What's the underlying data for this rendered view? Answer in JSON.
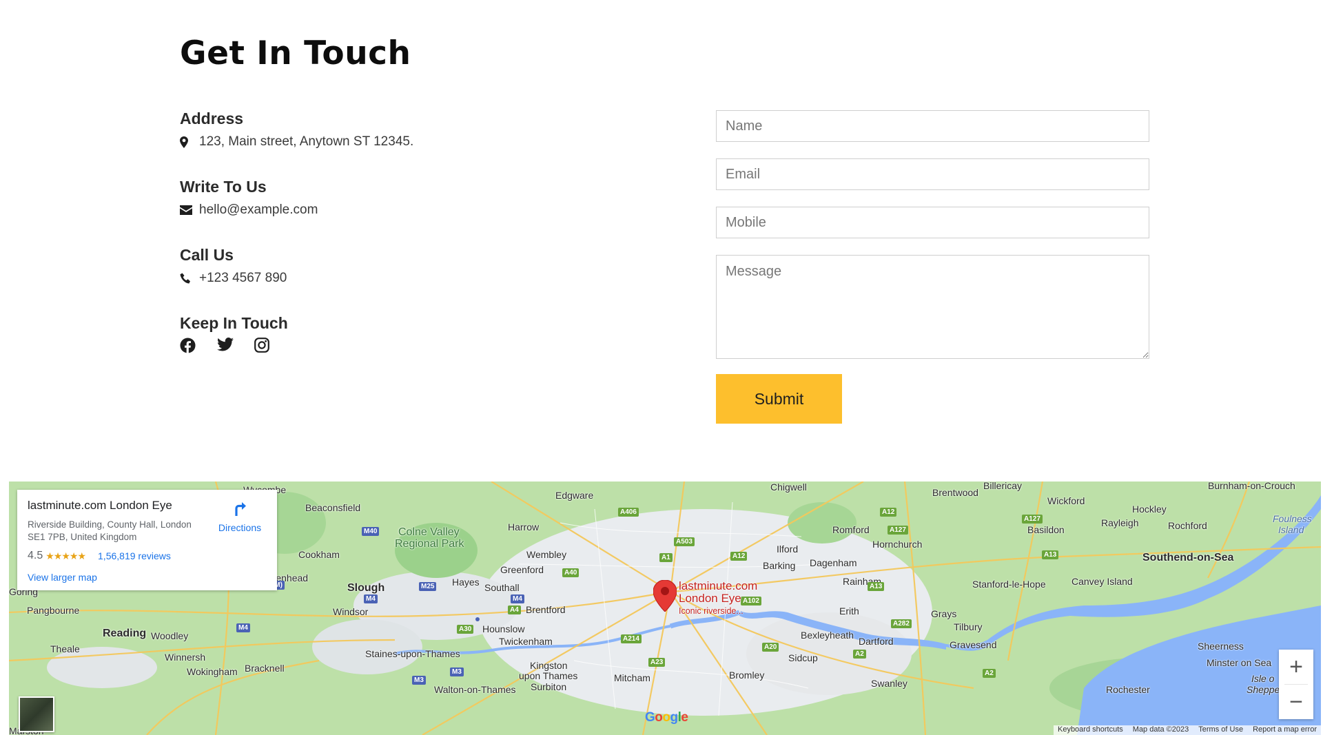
{
  "contact": {
    "title": "Get In Touch",
    "address": {
      "heading": "Address",
      "value": "123, Main street, Anytown ST 12345.",
      "icon": "map-marker-icon"
    },
    "write": {
      "heading": "Write To Us",
      "value": "hello@example.com",
      "icon": "envelope-icon"
    },
    "call": {
      "heading": "Call Us",
      "value": "+123 4567 890",
      "icon": "phone-icon"
    },
    "social": {
      "heading": "Keep In Touch",
      "icons": [
        "facebook-icon",
        "twitter-icon",
        "instagram-icon"
      ]
    }
  },
  "form": {
    "name_placeholder": "Name",
    "email_placeholder": "Email",
    "mobile_placeholder": "Mobile",
    "message_placeholder": "Message",
    "submit_label": "Submit",
    "submit_color": "#fdbf2d"
  },
  "map": {
    "card": {
      "title": "lastminute.com London Eye",
      "address": "Riverside Building, County Hall, London SE1 7PB, United Kingdom",
      "rating": "4.5",
      "stars": "★★★★★",
      "reviews": "1,56,819 reviews",
      "directions": "Directions",
      "larger_map": "View larger map"
    },
    "marker": {
      "line1": "lastminute.com",
      "line2": "London Eye",
      "line3": "Iconic riverside..."
    },
    "zoom_in": "+",
    "zoom_out": "−",
    "google_logo": "Google",
    "attribution": {
      "shortcuts": "Keyboard shortcuts",
      "data": "Map data ©2023",
      "terms": "Terms of Use",
      "report": "Report a map error"
    },
    "places": {
      "chigwell": "Chigwell",
      "brentwood": "Brentwood",
      "billericay": "Billericay",
      "burnham": "Burnham-on-Crouch",
      "edgware": "Edgware",
      "beaconsfield": "Beaconsfield",
      "wickford": "Wickford",
      "hockley": "Hockley",
      "harrow": "Harrow",
      "romford": "Romford",
      "basildon": "Basildon",
      "rayleigh": "Rayleigh",
      "rochford": "Rochford",
      "colne": "Colne Valley",
      "colne2": "Regional Park",
      "hornchurch": "Hornchurch",
      "foulness": "Foulness",
      "foulness2": "Island",
      "wembley": "Wembley",
      "ilford": "Ilford",
      "southend": "Southend-on-Sea",
      "greenford": "Greenford",
      "barking": "Barking",
      "dagenham": "Dagenham",
      "maidenhead": "Maidenhead",
      "hayes": "Hayes",
      "slough": "Slough",
      "southall": "Southall",
      "rainham": "Rainham",
      "stanford": "Stanford-le-Hope",
      "canvey": "Canvey Island",
      "pangbourne": "Pangbourne",
      "windsor": "Windsor",
      "brentford": "Brentford",
      "erith": "Erith",
      "grays": "Grays",
      "reading": "Reading",
      "woodley": "Woodley",
      "hounslow": "Hounslow",
      "tilbury": "Tilbury",
      "bexleyheath": "Bexleyheath",
      "theale": "Theale",
      "twickenham": "Twickenham",
      "dartford": "Dartford",
      "gravesend": "Gravesend",
      "sheerness": "Sheerness",
      "winnersh": "Winnersh",
      "staines": "Staines-upon-Thames",
      "sidcup": "Sidcup",
      "minster": "Minster on Sea",
      "wokingham": "Wokingham",
      "bracknell": "Bracknell",
      "kingston": "Kingston",
      "kingston2": "upon Thames",
      "bromley": "Bromley",
      "mitcham": "Mitcham",
      "isleof": "Isle o",
      "sheppey": "Sheppey",
      "surbiton": "Surbiton",
      "walton": "Walton-on-Thames",
      "swanley": "Swanley",
      "rochester": "Rochester",
      "cookham": "Cookham",
      "wycombe": "Wycombe",
      "goring": "Goring",
      "marlow": "Marston"
    }
  }
}
